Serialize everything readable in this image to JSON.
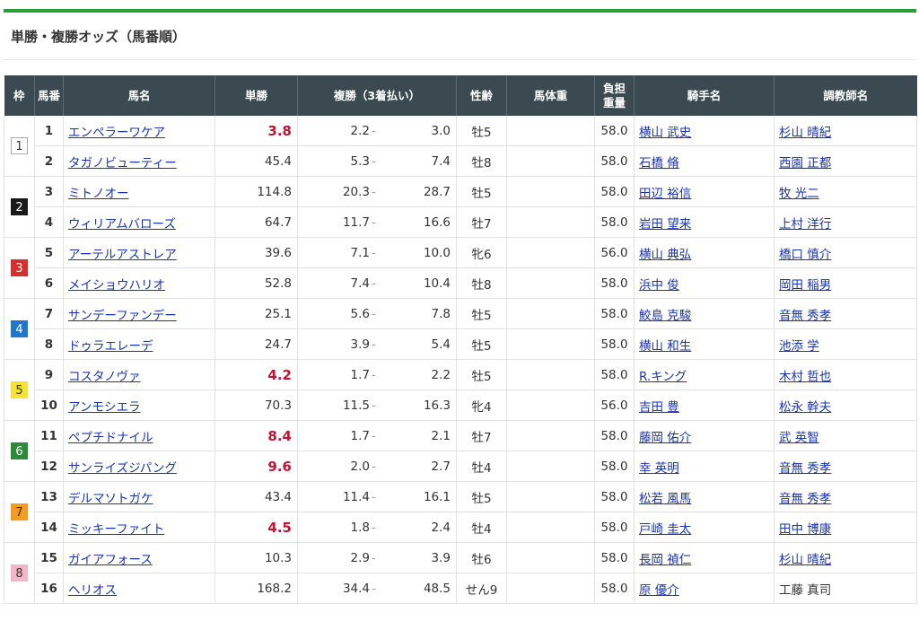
{
  "page": {
    "title": "単勝・複勝オッズ（馬番順）"
  },
  "colors": {
    "accent": "#2aa034",
    "header_bg": "#3a4a50",
    "link": "#1a33b5",
    "favorite": "#c41230"
  },
  "table": {
    "headers": {
      "waku": "枠",
      "umaban": "馬番",
      "name": "馬名",
      "win": "単勝",
      "place": "複勝（3着払い）",
      "sexage": "性齢",
      "weight": "馬体重",
      "load_line1": "負担",
      "load_line2": "重量",
      "jockey": "騎手名",
      "trainer": "調教師名"
    },
    "brackets": [
      {
        "number": "1",
        "bg": "#ffffff",
        "fg": "#333333",
        "border": "#aaaaaa"
      },
      {
        "number": "2",
        "bg": "#1a1a1a",
        "fg": "#ffffff",
        "border": "#1a1a1a"
      },
      {
        "number": "3",
        "bg": "#d32f2f",
        "fg": "#ffffff",
        "border": "#d32f2f"
      },
      {
        "number": "4",
        "bg": "#2176c9",
        "fg": "#ffffff",
        "border": "#2176c9"
      },
      {
        "number": "5",
        "bg": "#f5e233",
        "fg": "#333333",
        "border": "#f5e233"
      },
      {
        "number": "6",
        "bg": "#2e8b3a",
        "fg": "#ffffff",
        "border": "#2e8b3a"
      },
      {
        "number": "7",
        "bg": "#f39c1e",
        "fg": "#333333",
        "border": "#f39c1e"
      },
      {
        "number": "8",
        "bg": "#f5b5c8",
        "fg": "#333333",
        "border": "#f5b5c8"
      }
    ],
    "rows": [
      {
        "umaban": "1",
        "name": "エンペラーワケア",
        "win": "3.8",
        "fav": true,
        "place_low": "2.2",
        "place_dash": "-",
        "place_high": "3.0",
        "sexage": "牡5",
        "weight": "",
        "load": "58.0",
        "jockey": "横山 武史",
        "trainer": "杉山 晴紀",
        "trainer_link": true
      },
      {
        "umaban": "2",
        "name": "タガノビューティー",
        "win": "45.4",
        "fav": false,
        "place_low": "5.3",
        "place_dash": "-",
        "place_high": "7.4",
        "sexage": "牡8",
        "weight": "",
        "load": "58.0",
        "jockey": "石橋 脩",
        "trainer": "西園 正都",
        "trainer_link": true
      },
      {
        "umaban": "3",
        "name": "ミトノオー",
        "win": "114.8",
        "fav": false,
        "place_low": "20.3",
        "place_dash": "-",
        "place_high": "28.7",
        "sexage": "牡5",
        "weight": "",
        "load": "58.0",
        "jockey": "田辺 裕信",
        "trainer": "牧 光二",
        "trainer_link": true
      },
      {
        "umaban": "4",
        "name": "ウィリアムバローズ",
        "win": "64.7",
        "fav": false,
        "place_low": "11.7",
        "place_dash": "-",
        "place_high": "16.6",
        "sexage": "牡7",
        "weight": "",
        "load": "58.0",
        "jockey": "岩田 望来",
        "trainer": "上村 洋行",
        "trainer_link": true
      },
      {
        "umaban": "5",
        "name": "アーテルアストレア",
        "win": "39.6",
        "fav": false,
        "place_low": "7.1",
        "place_dash": "-",
        "place_high": "10.0",
        "sexage": "牝6",
        "weight": "",
        "load": "56.0",
        "jockey": "横山 典弘",
        "trainer": "橋口 慎介",
        "trainer_link": true
      },
      {
        "umaban": "6",
        "name": "メイショウハリオ",
        "win": "52.8",
        "fav": false,
        "place_low": "7.4",
        "place_dash": "-",
        "place_high": "10.4",
        "sexage": "牡8",
        "weight": "",
        "load": "58.0",
        "jockey": "浜中 俊",
        "trainer": "岡田 稲男",
        "trainer_link": true
      },
      {
        "umaban": "7",
        "name": "サンデーファンデー",
        "win": "25.1",
        "fav": false,
        "place_low": "5.6",
        "place_dash": "-",
        "place_high": "7.8",
        "sexage": "牡5",
        "weight": "",
        "load": "58.0",
        "jockey": "鮫島 克駿",
        "trainer": "音無 秀孝",
        "trainer_link": true
      },
      {
        "umaban": "8",
        "name": "ドゥラエレーデ",
        "win": "24.7",
        "fav": false,
        "place_low": "3.9",
        "place_dash": "-",
        "place_high": "5.4",
        "sexage": "牡5",
        "weight": "",
        "load": "58.0",
        "jockey": "横山 和生",
        "trainer": "池添 学",
        "trainer_link": true
      },
      {
        "umaban": "9",
        "name": "コスタノヴァ",
        "win": "4.2",
        "fav": true,
        "place_low": "1.7",
        "place_dash": "-",
        "place_high": "2.2",
        "sexage": "牡5",
        "weight": "",
        "load": "58.0",
        "jockey": "R.キング",
        "trainer": "木村 哲也",
        "trainer_link": true
      },
      {
        "umaban": "10",
        "name": "アンモシエラ",
        "win": "70.3",
        "fav": false,
        "place_low": "11.5",
        "place_dash": "-",
        "place_high": "16.3",
        "sexage": "牝4",
        "weight": "",
        "load": "56.0",
        "jockey": "吉田 豊",
        "trainer": "松永 幹夫",
        "trainer_link": true
      },
      {
        "umaban": "11",
        "name": "ペプチドナイル",
        "win": "8.4",
        "fav": true,
        "place_low": "1.7",
        "place_dash": "-",
        "place_high": "2.1",
        "sexage": "牡7",
        "weight": "",
        "load": "58.0",
        "jockey": "藤岡 佑介",
        "trainer": "武 英智",
        "trainer_link": true
      },
      {
        "umaban": "12",
        "name": "サンライズジパング",
        "win": "9.6",
        "fav": true,
        "place_low": "2.0",
        "place_dash": "-",
        "place_high": "2.7",
        "sexage": "牡4",
        "weight": "",
        "load": "58.0",
        "jockey": "幸 英明",
        "trainer": "音無 秀孝",
        "trainer_link": true
      },
      {
        "umaban": "13",
        "name": "デルマソトガケ",
        "win": "43.4",
        "fav": false,
        "place_low": "11.4",
        "place_dash": "-",
        "place_high": "16.1",
        "sexage": "牡5",
        "weight": "",
        "load": "58.0",
        "jockey": "松若 風馬",
        "trainer": "音無 秀孝",
        "trainer_link": true
      },
      {
        "umaban": "14",
        "name": "ミッキーファイト",
        "win": "4.5",
        "fav": true,
        "place_low": "1.8",
        "place_dash": "-",
        "place_high": "2.4",
        "sexage": "牡4",
        "weight": "",
        "load": "58.0",
        "jockey": "戸崎 圭太",
        "trainer": "田中 博康",
        "trainer_link": true
      },
      {
        "umaban": "15",
        "name": "ガイアフォース",
        "win": "10.3",
        "fav": false,
        "place_low": "2.9",
        "place_dash": "-",
        "place_high": "3.9",
        "sexage": "牡6",
        "weight": "",
        "load": "58.0",
        "jockey": "長岡 禎仁",
        "trainer": "杉山 晴紀",
        "trainer_link": true
      },
      {
        "umaban": "16",
        "name": "ヘリオス",
        "win": "168.2",
        "fav": false,
        "place_low": "34.4",
        "place_dash": "-",
        "place_high": "48.5",
        "sexage": "せん9",
        "weight": "",
        "load": "58.0",
        "jockey": "原 優介",
        "trainer": "工藤 真司",
        "trainer_link": false
      }
    ]
  }
}
